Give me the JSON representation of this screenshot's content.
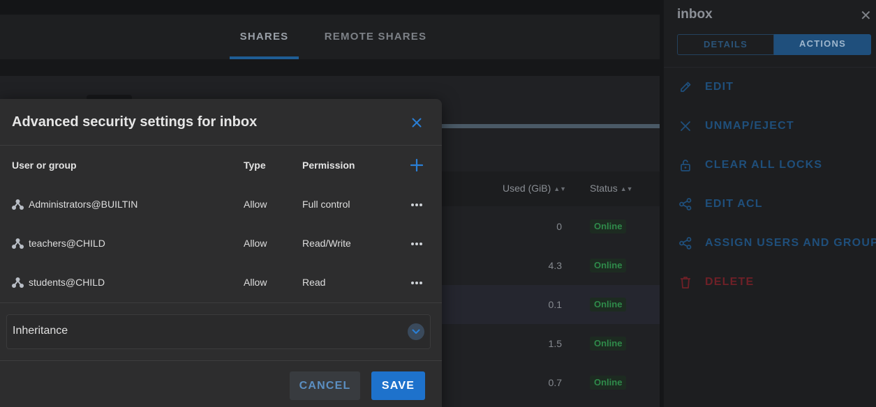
{
  "tabs": [
    {
      "label": "SHARES",
      "active": true
    },
    {
      "label": "REMOTE SHARES",
      "active": false
    }
  ],
  "table": {
    "headers": {
      "used": "Used (GiB)",
      "status": "Status"
    },
    "rows": [
      {
        "used": "0",
        "status": "Online"
      },
      {
        "used": "4.3",
        "status": "Online"
      },
      {
        "used": "0.1",
        "status": "Online"
      },
      {
        "used": "1.5",
        "status": "Online"
      },
      {
        "used": "0.7",
        "status": "Online"
      }
    ]
  },
  "side_panel": {
    "title": "inbox",
    "close_glyph": "✕",
    "tabs": [
      {
        "label": "DETAILS",
        "active": false
      },
      {
        "label": "ACTIONS",
        "active": true
      }
    ],
    "actions": [
      {
        "label": "EDIT",
        "icon": "pencil-icon"
      },
      {
        "label": "UNMAP/EJECT",
        "icon": "close-icon"
      },
      {
        "label": "CLEAR ALL LOCKS",
        "icon": "unlock-icon"
      },
      {
        "label": "EDIT ACL",
        "icon": "share-icon"
      },
      {
        "label": "ASSIGN USERS AND GROUPS",
        "icon": "share-icon"
      },
      {
        "label": "DELETE",
        "icon": "trash-icon"
      }
    ]
  },
  "modal": {
    "title": "Advanced security settings for inbox",
    "columns": {
      "user": "User or group",
      "type": "Type",
      "permission": "Permission"
    },
    "entries": [
      {
        "name": "Administrators@BUILTIN",
        "type": "Allow",
        "permission": "Full control",
        "icon": "group-icon"
      },
      {
        "name": "teachers@CHILD",
        "type": "Allow",
        "permission": "Read/Write",
        "icon": "group-icon"
      },
      {
        "name": "students@CHILD",
        "type": "Allow",
        "permission": "Read",
        "icon": "group-icon"
      }
    ],
    "inheritance_label": "Inheritance",
    "cancel_label": "CANCEL",
    "save_label": "SAVE"
  },
  "colors": {
    "accent": "#1e72cc",
    "status_online": "#2f8a4a",
    "danger": "#6e2027"
  }
}
